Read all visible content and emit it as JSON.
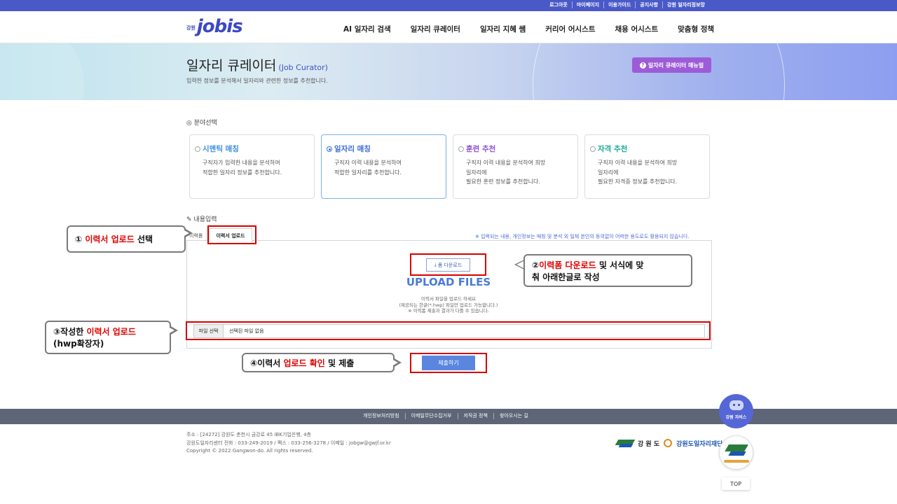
{
  "topbar": {
    "links": [
      "로그아웃",
      "마이페이지",
      "이용가이드",
      "공지사항",
      "강원 일자리정보망"
    ]
  },
  "header": {
    "logo_small": "강원",
    "logo_big": "jobis",
    "nav": [
      "AI 일자리 검색",
      "일자리 큐레이터",
      "일자리 지혜 쌤",
      "커리어 어시스트",
      "채용 어시스트",
      "맞춤형 정책"
    ]
  },
  "banner": {
    "title": "일자리 큐레이터",
    "title_en": "(Job Curator)",
    "desc": "입력한 정보를 분석해서 일자리와 관련한 정보를 추천합니다.",
    "manual_label": "일자리 큐레이터 매뉴얼"
  },
  "field_select": {
    "label": "분야선택",
    "cards": [
      {
        "title": "시맨틱 매칭",
        "desc": "구직자가 입력한 내용을 분석하여\n적합한 일자리 정보를 추천합니다.",
        "selected": false
      },
      {
        "title": "일자리 매칭",
        "desc": "구직자 이력 내용을 분석하여\n적합한 일자리를 추천합니다.",
        "selected": true
      },
      {
        "title": "훈련 추천",
        "desc": "구직자 이력 내용을 분석하여 희망\n일자리에\n필요한 훈련 정보를 추천합니다.",
        "selected": false
      },
      {
        "title": "자격 추천",
        "desc": "구직자 이력 내용을 분석하여 희망\n일자리에\n필요한 자격증 정보를 추천합니다.",
        "selected": false
      }
    ]
  },
  "content_input": {
    "label": "내용입력",
    "tab_plain": "이력폼",
    "tab_active": "이력서 업로드",
    "notice": "※ 입력되는 내용, 개인정보는 매칭 및 분석 외 일체 본인의 동의없이 어떠한 용도로도 활용되지 않습니다.",
    "form_download": "폼 다운로드",
    "upload_title": "UPLOAD FILES",
    "upload_info": [
      "이력서 파일을 업로드 하세요",
      "(제공되는 한글(*.hwp) 파일만 업로드 가능합니다.)",
      "※ 이력폼 제출과 결과가 다를 수 있습니다."
    ],
    "file_button": "파일 선택",
    "file_name": "선택된 파일 없음",
    "submit": "제출하기"
  },
  "callouts": {
    "c1": {
      "prefix": "① ",
      "red": "이력서 업로드",
      "suffix": " 선택"
    },
    "c2": {
      "prefix": "②",
      "red": "이력폼 다운로드",
      "suffix": " 및 서식에 맞",
      "line2": "춰 아래한글로 작성"
    },
    "c3": {
      "prefix": "③작성한 ",
      "red": "이력서 업로드",
      "line2": "(hwp확장자)"
    },
    "c4": {
      "prefix": "④이력서 ",
      "red": "업로드 확인",
      "suffix": " 및 제출"
    }
  },
  "footer": {
    "links": [
      "개인정보처리방침",
      "이메일무단수집거부",
      "저작권 정책",
      "찾아오시는 길"
    ],
    "address": [
      "주소 : [24272] 강원도 춘천시 금강로 45 IBK기업은행, 4층",
      "강원도일자리센터 전화 : 033-249-2019 / 팩스 : 033-256-3278 / 이메일 : jobgw@gwjf.or.kr",
      "Copyright © 2022 Gangwon-do. All rights reserved."
    ],
    "logo1": "강 원 도",
    "logo2": "강원도일자리재단",
    "bot_label": "강원 자비스",
    "top": "TOP"
  },
  "colors": {
    "accent": "#4a59c8",
    "highlight": "#d60000",
    "submit": "#5a86e0"
  }
}
